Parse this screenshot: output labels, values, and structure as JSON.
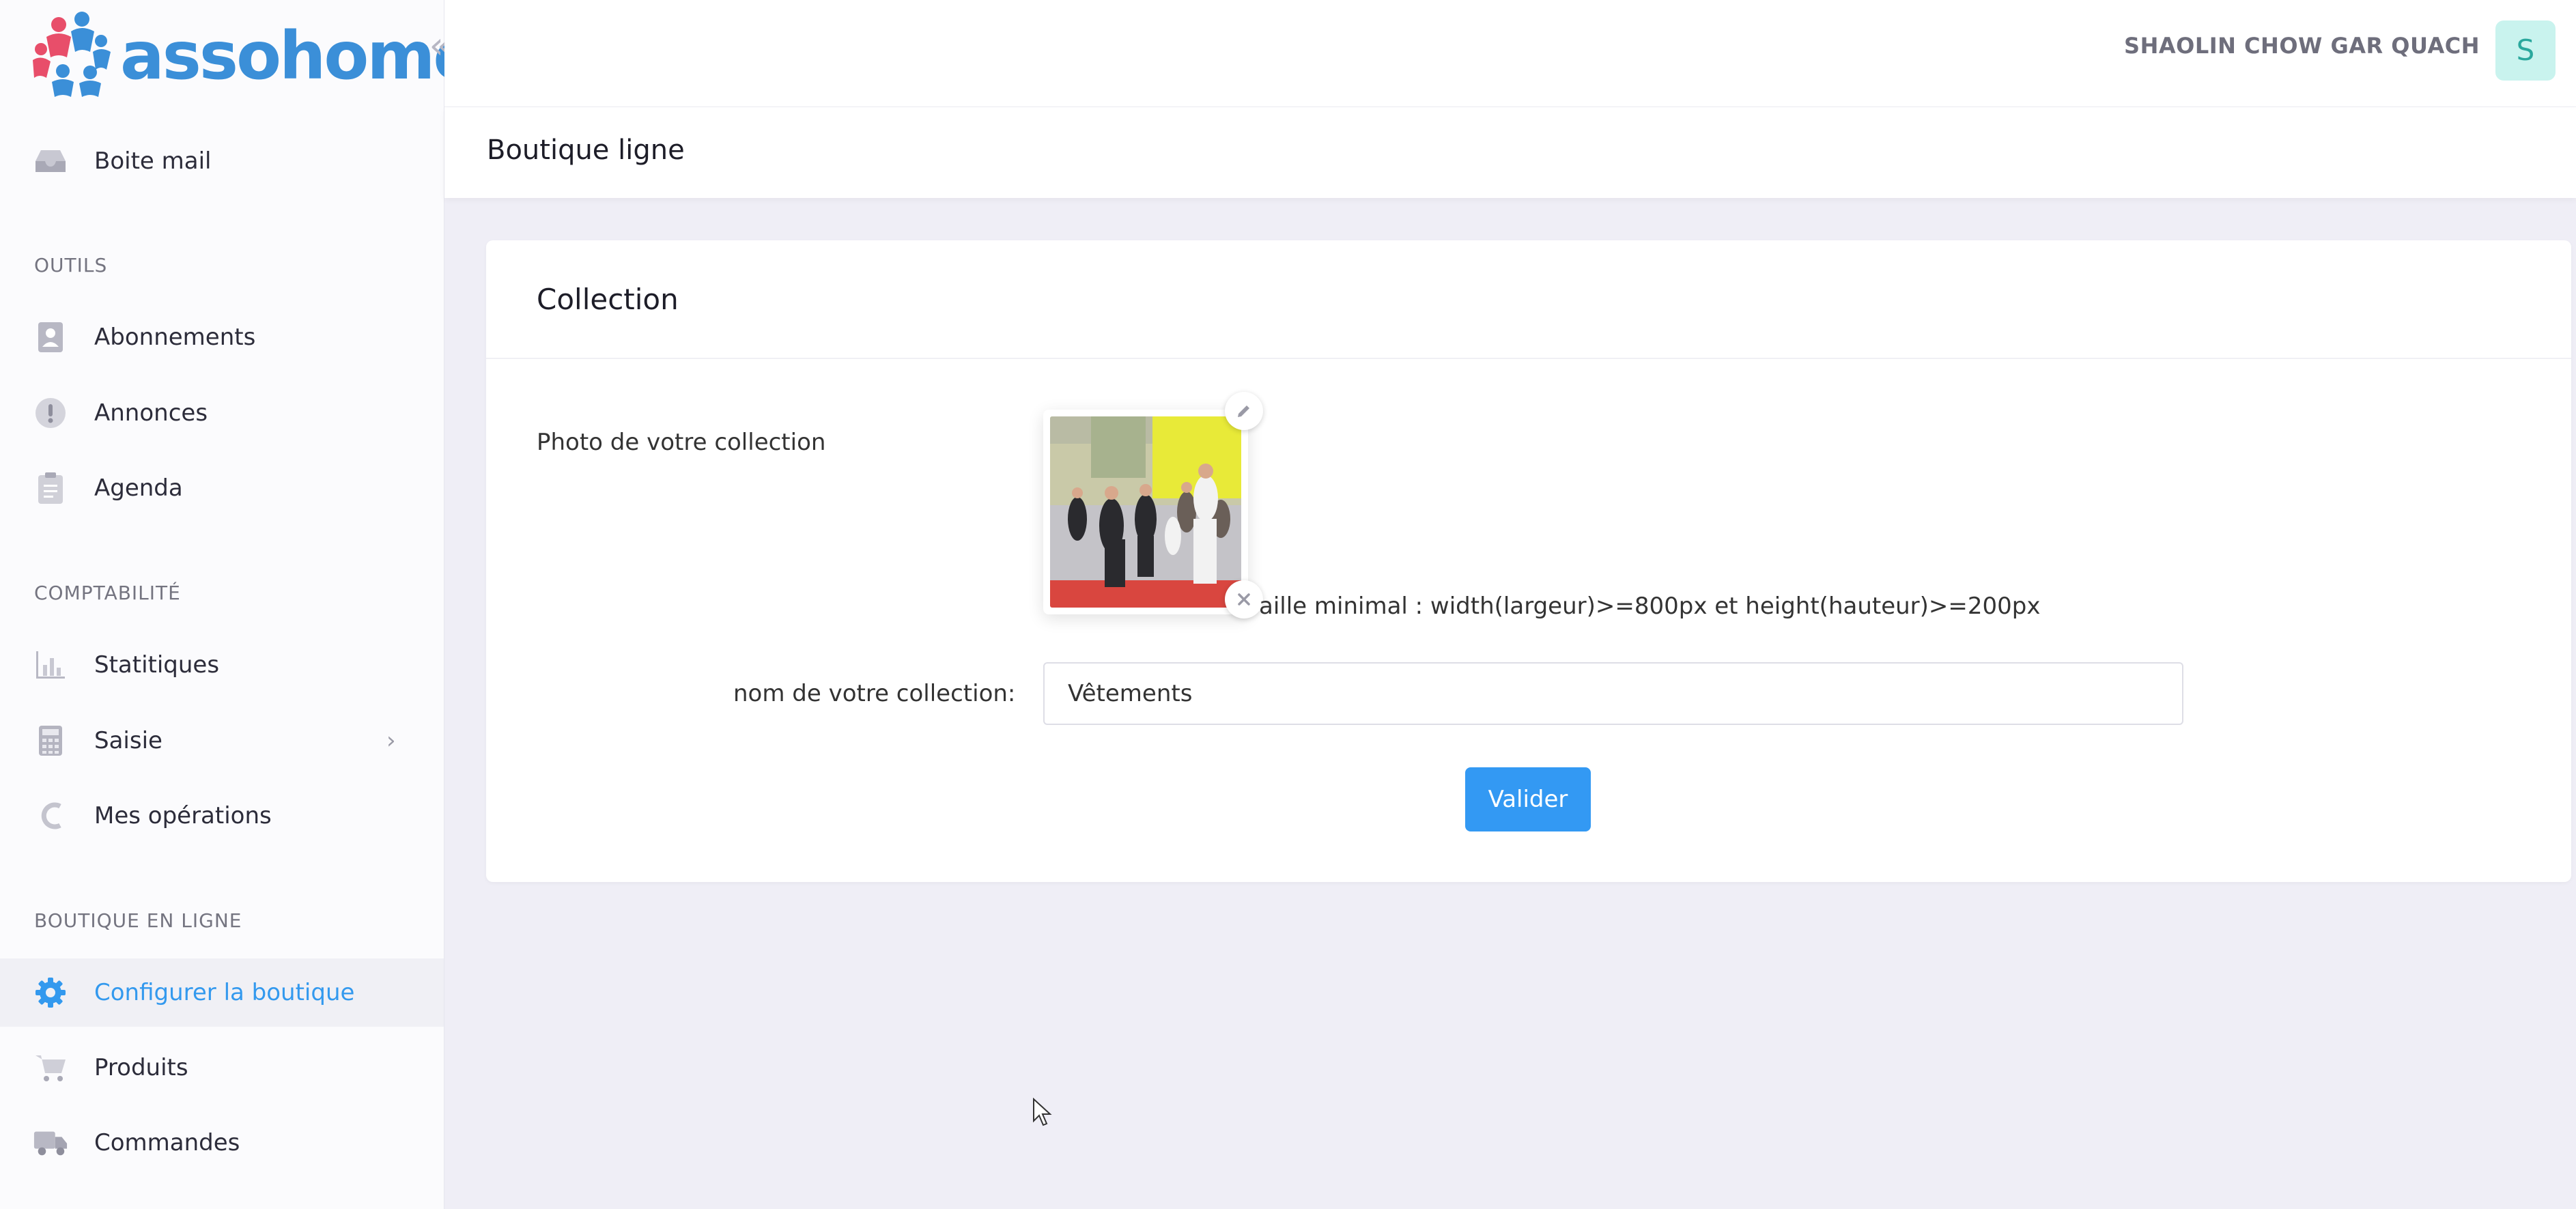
{
  "brand": {
    "name": "assohome",
    "color": "#3b8fd8",
    "accent": "#e84e6a"
  },
  "user": {
    "name": "SHAOLIN CHOW GAR QUACH",
    "initial": "S"
  },
  "sidebar": {
    "top_items": [
      {
        "label": "Boite mail",
        "icon": "inbox-icon"
      }
    ],
    "sections": [
      {
        "title": "OUTILS",
        "items": [
          {
            "label": "Abonnements",
            "icon": "contact-book-icon"
          },
          {
            "label": "Annonces",
            "icon": "exclamation-icon"
          },
          {
            "label": "Agenda",
            "icon": "clipboard-icon"
          }
        ]
      },
      {
        "title": "COMPTABILITÉ",
        "items": [
          {
            "label": "Statitiques",
            "icon": "bar-chart-icon"
          },
          {
            "label": "Saisie",
            "icon": "calculator-icon"
          },
          {
            "label": "Mes opérations",
            "icon": "euro-icon"
          }
        ]
      },
      {
        "title": "BOUTIQUE EN LIGNE",
        "items": [
          {
            "label": "Configurer la boutique",
            "icon": "gear-icon",
            "active": true
          },
          {
            "label": "Produits",
            "icon": "cart-icon"
          },
          {
            "label": "Commandes",
            "icon": "truck-icon"
          }
        ]
      }
    ]
  },
  "page": {
    "title": "Boutique ligne"
  },
  "form": {
    "card_title": "Collection",
    "photo_label": "Photo de votre collection",
    "size_note": "aille minimal : width(largeur)>=800px et height(hauteur)>=200px",
    "name_label": "nom de votre collection:",
    "name_value": "Vêtements",
    "submit_label": "Valider"
  },
  "colors": {
    "primary": "#3399f3",
    "active_text": "#3399ee",
    "background": "#efeef6"
  }
}
